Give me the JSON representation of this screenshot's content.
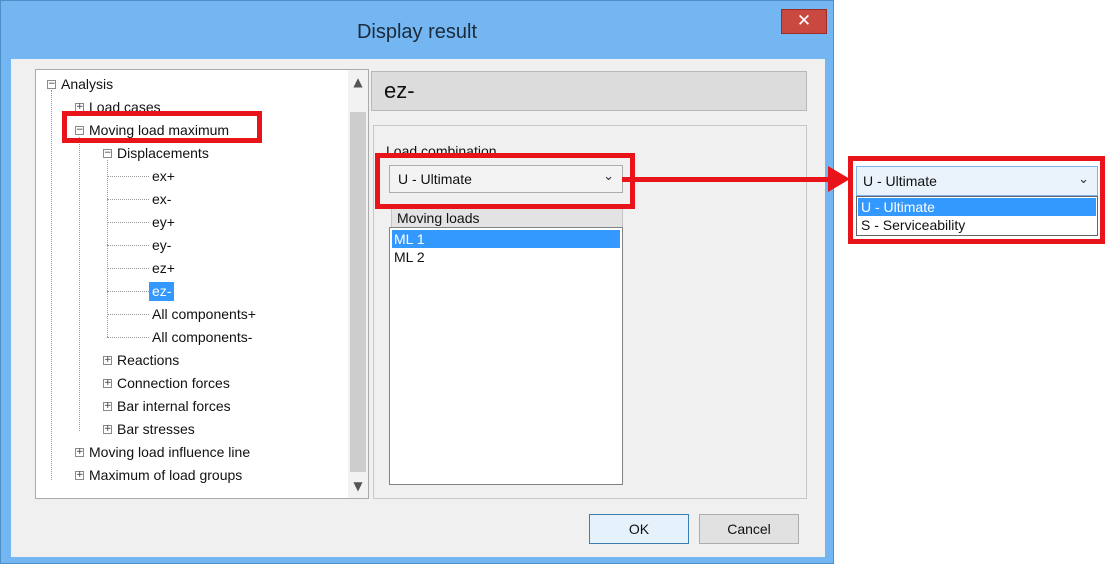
{
  "window": {
    "title": "Display result",
    "close_glyph": "✕"
  },
  "tree": {
    "items": [
      {
        "label": "Analysis",
        "expander": "−"
      },
      {
        "label": "Load cases",
        "expander": "+"
      },
      {
        "label": "Moving load maximum",
        "expander": "−"
      },
      {
        "label": "Displacements",
        "expander": "−"
      },
      {
        "label": "ex+"
      },
      {
        "label": "ex-"
      },
      {
        "label": "ey+"
      },
      {
        "label": "ey-"
      },
      {
        "label": "ez+"
      },
      {
        "label": "ez-",
        "selected": true
      },
      {
        "label": "All components+"
      },
      {
        "label": "All components-"
      },
      {
        "label": "Reactions",
        "expander": "+"
      },
      {
        "label": "Connection forces",
        "expander": "+"
      },
      {
        "label": "Bar internal forces",
        "expander": "+"
      },
      {
        "label": "Bar stresses",
        "expander": "+"
      },
      {
        "label": "Moving load influence line",
        "expander": "+"
      },
      {
        "label": "Maximum of load groups",
        "expander": "+"
      }
    ],
    "scroll_up": "▲",
    "scroll_down": "▼"
  },
  "result": {
    "heading": "ez-",
    "load_combination_label": "Load combination",
    "load_combination_value": "U - Ultimate",
    "chevron": "⌄",
    "moving_loads_header": "Moving loads",
    "moving_loads": [
      {
        "label": "ML 1",
        "selected": true
      },
      {
        "label": "ML 2"
      }
    ]
  },
  "buttons": {
    "ok": "OK",
    "cancel": "Cancel"
  },
  "zoom_dropdown": {
    "value": "U - Ultimate",
    "options": [
      {
        "label": "U - Ultimate",
        "selected": true
      },
      {
        "label": "S - Serviceability"
      }
    ]
  },
  "colors": {
    "highlight_red": "#e8141a",
    "selection_blue": "#3399ff",
    "title_bar": "#73b6f2",
    "close_button": "#c9483f"
  }
}
